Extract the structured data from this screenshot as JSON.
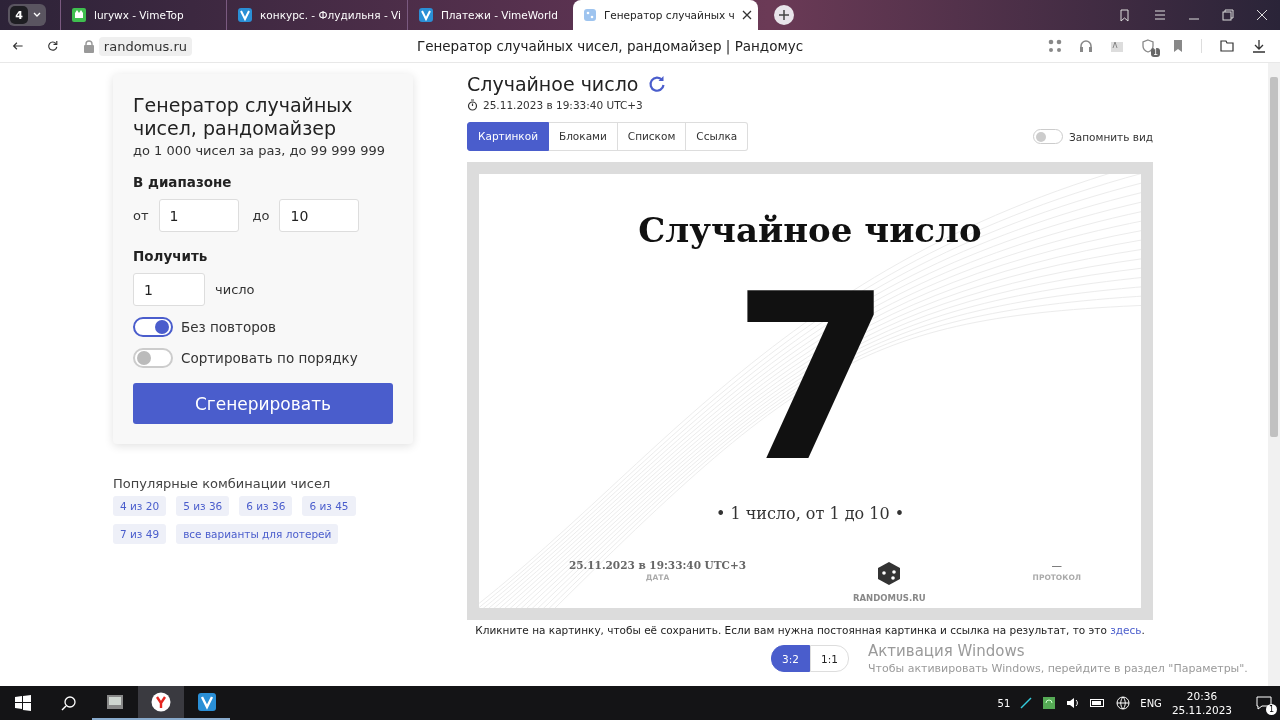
{
  "browser": {
    "tab_count": "4",
    "tabs": [
      {
        "title": "lurywx - VimeTop",
        "selected": false
      },
      {
        "title": "конкурс. - Флудильня - Vi",
        "selected": false
      },
      {
        "title": "Платежи - VimeWorld",
        "selected": false
      },
      {
        "title": "Генератор случайных ч",
        "selected": true
      }
    ],
    "address": "randomus.ru",
    "page_title": "Генератор случайных чисел, рандомайзер | Рандомус",
    "protect_badge": "1"
  },
  "form": {
    "title": "Генератор случайных чисел, рандомайзер",
    "subtitle": "до 1 000 чисел за раз, до 99 999 999",
    "range_label": "В диапазоне",
    "from_label": "от",
    "from_value": "1",
    "to_label": "до",
    "to_value": "10",
    "count_label": "Получить",
    "count_value": "1",
    "count_unit": "число",
    "toggles": [
      {
        "label": "Без повторов",
        "on": true
      },
      {
        "label": "Сортировать по порядку",
        "on": false
      }
    ],
    "button": "Сгенерировать"
  },
  "popular": {
    "title": "Популярные комбинации чисел",
    "chips": [
      "4 из 20",
      "5 из 36",
      "6 из 36",
      "6 из 45",
      "7 из 49",
      "все варианты для лотерей"
    ]
  },
  "result": {
    "title": "Случайное число",
    "timestamp": "25.11.2023 в 19:33:40 UTC+3",
    "view_tabs": [
      {
        "label": "Картинкой",
        "selected": true
      },
      {
        "label": "Блоками",
        "selected": false
      },
      {
        "label": "Списком",
        "selected": false
      },
      {
        "label": "Ссылка",
        "selected": false
      }
    ],
    "remember": {
      "label": "Запомнить вид",
      "on": false
    },
    "image": {
      "heading": "Случайное число",
      "number": "7",
      "caption": "• 1 число, от 1 до 10 •",
      "date": "25.11.2023 в 19:33:40 UTC+3",
      "date_label": "ДАТА",
      "brand": "RANDOMUS.RU",
      "protocol": "—",
      "protocol_label": "ПРОТОКОЛ"
    },
    "note": "Кликните на картинку, чтобы её сохранить. Если вам нужна постоянная картинка и ссылка на результат, то это",
    "note_link": "здесь",
    "note_end": ".",
    "ratios": [
      {
        "label": "3:2",
        "selected": true
      },
      {
        "label": "1:1",
        "selected": false
      }
    ]
  },
  "windows_notice": {
    "title": "Активация Windows",
    "text": "Чтобы активировать Windows, перейдите в раздел \"Параметры\"."
  },
  "taskbar": {
    "battery": "51",
    "language": "ENG",
    "time": "20:36",
    "date": "25.11.2023",
    "notifications": "1"
  }
}
